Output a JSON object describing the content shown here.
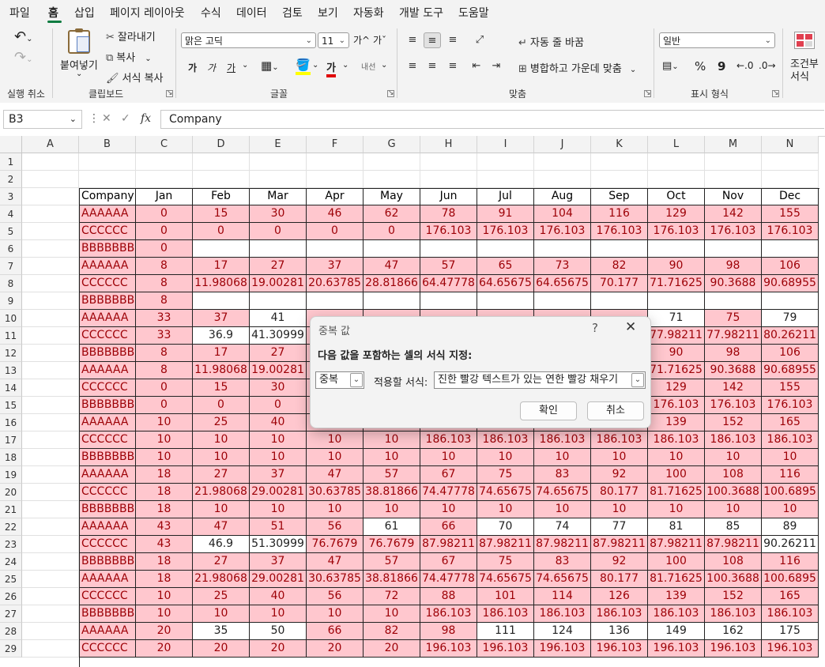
{
  "menu": {
    "items": [
      "파일",
      "홈",
      "삽입",
      "페이지 레이아웃",
      "수식",
      "데이터",
      "검토",
      "보기",
      "자동화",
      "개발 도구",
      "도움말"
    ],
    "active": "홈"
  },
  "ribbon": {
    "groups": {
      "undo": "실행 취소",
      "clipboard": "클립보드",
      "font": "글꼴",
      "alignment": "맞춤",
      "number": "표시 형식"
    },
    "paste_label": "붙여넣기",
    "cut_label": "잘라내기",
    "copy_label": "복사",
    "format_painter_label": "서식 복사",
    "font_name": "맑은 고딕",
    "font_size": "11",
    "bold_label": "가",
    "italic_label": "가",
    "underline_label": "가",
    "font_color_label": "가",
    "phonetic_label": "내선",
    "wrap_text_label": "자동 줄 바꿈",
    "merge_label": "병합하고 가운데 맞춤",
    "number_format": "일반",
    "conditional_label_1": "조건부",
    "conditional_label_2": "서식",
    "grow_font": "가^",
    "shrink_font": "가ˇ",
    "percent": "%",
    "comma": "9"
  },
  "formula_bar": {
    "name_box": "B3",
    "fx": "fx",
    "content": "Company"
  },
  "sheet": {
    "columns": [
      "A",
      "B",
      "C",
      "D",
      "E",
      "F",
      "G",
      "H",
      "I",
      "J",
      "K",
      "L",
      "M",
      "N"
    ],
    "rows": [
      "1",
      "2",
      "3",
      "4",
      "5",
      "6",
      "7",
      "8",
      "9",
      "10",
      "11",
      "12",
      "13",
      "14",
      "15",
      "16",
      "17",
      "18",
      "19",
      "20",
      "21",
      "22",
      "23",
      "24",
      "25",
      "26",
      "27",
      "28",
      "29"
    ],
    "header": [
      "Company",
      "Jan",
      "Feb",
      "Mar",
      "Apr",
      "May",
      "Jun",
      "Jul",
      "Aug",
      "Sep",
      "Oct",
      "Nov",
      "Dec"
    ],
    "data": [
      [
        "AAAAAA",
        "0",
        "15",
        "30",
        "46",
        "62",
        "78",
        "91",
        "104",
        "116",
        "129",
        "142",
        "155"
      ],
      [
        "CCCCCC",
        "0",
        "0",
        "0",
        "0",
        "0",
        "176.103",
        "176.103",
        "176.103",
        "176.103",
        "176.103",
        "176.103",
        "176.103"
      ],
      [
        "BBBBBBB",
        "0",
        "",
        "",
        "",
        "",
        "",
        "",
        "",
        "",
        "",
        "",
        ""
      ],
      [
        "AAAAAA",
        "8",
        "17",
        "27",
        "37",
        "47",
        "57",
        "65",
        "73",
        "82",
        "90",
        "98",
        "106"
      ],
      [
        "CCCCCC",
        "8",
        "11.98068",
        "19.00281",
        "20.63785",
        "28.81866",
        "64.47778",
        "64.65675",
        "64.65675",
        "70.177",
        "71.71625",
        "90.3688",
        "90.68955"
      ],
      [
        "BBBBBBB",
        "8",
        "",
        "",
        "",
        "",
        "",
        "",
        "",
        "",
        "",
        "",
        ""
      ],
      [
        "AAAAAA",
        "33",
        "37",
        "41",
        "",
        "",
        "",
        "",
        "",
        "",
        "71",
        "75",
        "79"
      ],
      [
        "CCCCCC",
        "33",
        "36.9",
        "41.30999",
        "",
        "",
        "",
        "",
        "",
        "",
        "77.98211",
        "77.98211",
        "80.26211"
      ],
      [
        "BBBBBBB",
        "8",
        "17",
        "27",
        "",
        "",
        "",
        "",
        "",
        "",
        "90",
        "98",
        "106"
      ],
      [
        "AAAAAA",
        "8",
        "11.98068",
        "19.00281",
        "",
        "",
        "",
        "",
        "",
        "",
        "71.71625",
        "90.3688",
        "90.68955"
      ],
      [
        "CCCCCC",
        "0",
        "15",
        "30",
        "",
        "",
        "",
        "",
        "",
        "",
        "129",
        "142",
        "155"
      ],
      [
        "BBBBBBB",
        "0",
        "0",
        "0",
        "",
        "",
        "",
        "",
        "",
        "",
        "176.103",
        "176.103",
        "176.103"
      ],
      [
        "AAAAAA",
        "10",
        "25",
        "40",
        "",
        "",
        "",
        "",
        "",
        "",
        "139",
        "152",
        "165"
      ],
      [
        "CCCCCC",
        "10",
        "10",
        "10",
        "10",
        "10",
        "186.103",
        "186.103",
        "186.103",
        "186.103",
        "186.103",
        "186.103",
        "186.103"
      ],
      [
        "BBBBBBB",
        "10",
        "10",
        "10",
        "10",
        "10",
        "10",
        "10",
        "10",
        "10",
        "10",
        "10",
        "10"
      ],
      [
        "AAAAAA",
        "18",
        "27",
        "37",
        "47",
        "57",
        "67",
        "75",
        "83",
        "92",
        "100",
        "108",
        "116"
      ],
      [
        "CCCCCC",
        "18",
        "21.98068",
        "29.00281",
        "30.63785",
        "38.81866",
        "74.47778",
        "74.65675",
        "74.65675",
        "80.177",
        "81.71625",
        "100.3688",
        "100.6895"
      ],
      [
        "BBBBBBB",
        "18",
        "10",
        "10",
        "10",
        "10",
        "10",
        "10",
        "10",
        "10",
        "10",
        "10",
        "10"
      ],
      [
        "AAAAAA",
        "43",
        "47",
        "51",
        "56",
        "61",
        "66",
        "70",
        "74",
        "77",
        "81",
        "85",
        "89"
      ],
      [
        "CCCCCC",
        "43",
        "46.9",
        "51.30999",
        "76.7679",
        "76.7679",
        "87.98211",
        "87.98211",
        "87.98211",
        "87.98211",
        "87.98211",
        "87.98211",
        "90.26211"
      ],
      [
        "BBBBBBB",
        "18",
        "27",
        "37",
        "47",
        "57",
        "67",
        "75",
        "83",
        "92",
        "100",
        "108",
        "116"
      ],
      [
        "AAAAAA",
        "18",
        "21.98068",
        "29.00281",
        "30.63785",
        "38.81866",
        "74.47778",
        "74.65675",
        "74.65675",
        "80.177",
        "81.71625",
        "100.3688",
        "100.6895"
      ],
      [
        "CCCCCC",
        "10",
        "25",
        "40",
        "56",
        "72",
        "88",
        "101",
        "114",
        "126",
        "139",
        "152",
        "165"
      ],
      [
        "BBBBBBB",
        "10",
        "10",
        "10",
        "10",
        "10",
        "186.103",
        "186.103",
        "186.103",
        "186.103",
        "186.103",
        "186.103",
        "186.103"
      ],
      [
        "AAAAAA",
        "20",
        "35",
        "50",
        "66",
        "82",
        "98",
        "111",
        "124",
        "136",
        "149",
        "162",
        "175"
      ],
      [
        "CCCCCC",
        "20",
        "20",
        "20",
        "20",
        "20",
        "196.103",
        "196.103",
        "196.103",
        "196.103",
        "196.103",
        "196.103",
        "196.103"
      ]
    ],
    "plain_cells": [
      [
        2,
        2
      ],
      [
        2,
        3
      ],
      [
        2,
        4
      ],
      [
        2,
        5
      ],
      [
        2,
        6
      ],
      [
        2,
        7
      ],
      [
        2,
        8
      ],
      [
        2,
        9
      ],
      [
        2,
        10
      ],
      [
        2,
        11
      ],
      [
        2,
        12
      ],
      [
        5,
        2
      ],
      [
        5,
        3
      ],
      [
        5,
        4
      ],
      [
        5,
        5
      ],
      [
        5,
        6
      ],
      [
        5,
        7
      ],
      [
        5,
        8
      ],
      [
        5,
        9
      ],
      [
        5,
        10
      ],
      [
        5,
        11
      ],
      [
        5,
        12
      ],
      [
        6,
        3
      ],
      [
        6,
        10
      ],
      [
        6,
        12
      ],
      [
        7,
        2
      ],
      [
        7,
        3
      ],
      [
        18,
        5
      ],
      [
        18,
        7
      ],
      [
        18,
        8
      ],
      [
        18,
        9
      ],
      [
        18,
        10
      ],
      [
        18,
        11
      ],
      [
        18,
        12
      ],
      [
        19,
        2
      ],
      [
        19,
        3
      ],
      [
        19,
        12
      ],
      [
        24,
        2
      ],
      [
        24,
        3
      ],
      [
        24,
        7
      ],
      [
        24,
        8
      ],
      [
        24,
        9
      ],
      [
        24,
        10
      ],
      [
        24,
        11
      ],
      [
        24,
        12
      ]
    ],
    "duplicate_fill": "#ffc7ce",
    "duplicate_text": "#9c0006"
  },
  "dialog": {
    "title": "중복 값",
    "help": "?",
    "close": "✕",
    "prompt": "다음 값을 포함하는 셀의 서식 지정:",
    "rule_type": "중복",
    "apply_label": "적용할 서식:",
    "format_value": "진한 빨강 텍스트가 있는 연한 빨강 채우기",
    "ok_label": "확인",
    "cancel_label": "취소"
  }
}
